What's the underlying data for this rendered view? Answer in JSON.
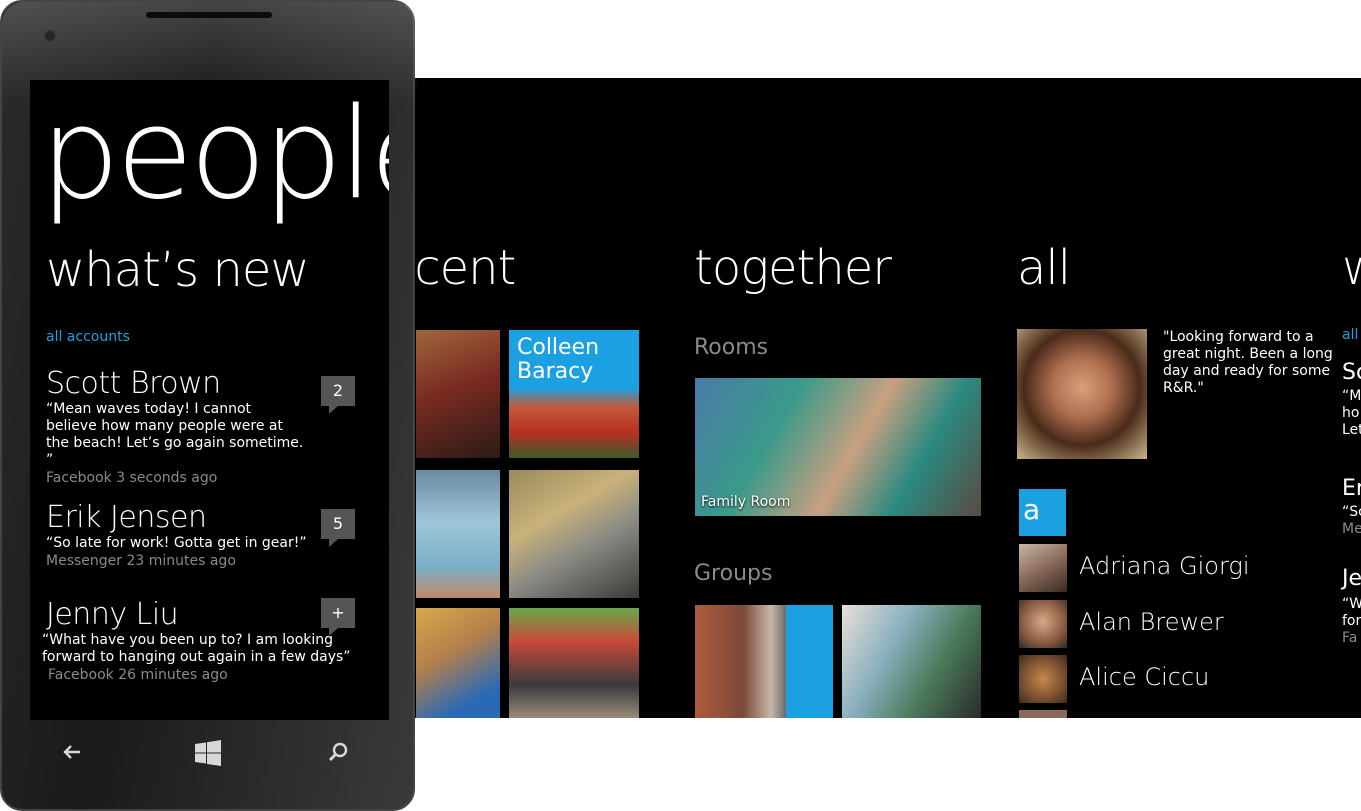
{
  "app": {
    "title": "people",
    "accent_color": "#1ba1e2"
  },
  "sections": {
    "whats_new": "what’s new",
    "recent": "recent",
    "together": "together",
    "all": "all",
    "partial_next": "w"
  },
  "whats_new": {
    "filter": "all accounts",
    "items": [
      {
        "name": "Scott Brown",
        "message": "“Mean waves today! I cannot believe how many people were at the beach! Let’s go again sometime. ”",
        "source": "Facebook 3 seconds ago",
        "badge": "2"
      },
      {
        "name": "Erik Jensen",
        "message": "“So late for work! Gotta get in gear!”",
        "source": "Messenger 23 minutes ago",
        "badge": "5"
      },
      {
        "name": "Jenny Liu",
        "message": "“What have you been up to? I am looking forward to hanging out again in a few days”",
        "source": "Facebook 26 minutes ago",
        "badge": "+"
      }
    ]
  },
  "recent": {
    "tiles": [
      {
        "label": ""
      },
      {
        "label": ""
      },
      {
        "label": "Colleen Baracy"
      },
      {
        "label": ""
      },
      {
        "label": ""
      },
      {
        "label": ""
      },
      {
        "label": ""
      },
      {
        "label": ""
      },
      {
        "label": ""
      }
    ]
  },
  "together": {
    "rooms_header": "Rooms",
    "room_tile_label": "Family Room",
    "groups_header": "Groups"
  },
  "all": {
    "me_status": "\"Looking forward to a great night. Been a long day and ready for some R&R.\"",
    "letter": "a",
    "contacts": [
      {
        "name": "Adriana Giorgi"
      },
      {
        "name": "Alan Brewer"
      },
      {
        "name": "Alice Ciccu"
      }
    ]
  },
  "partial_column": {
    "filter": "all",
    "lines": [
      "Sc",
      "“M",
      "ho",
      "Let",
      "Er",
      "“Sc",
      "Me",
      "Je",
      "“W",
      "for",
      "Fa"
    ]
  },
  "hardware_buttons": {
    "back_icon": "back-arrow-icon",
    "start_icon": "windows-logo-icon",
    "search_icon": "search-icon"
  }
}
